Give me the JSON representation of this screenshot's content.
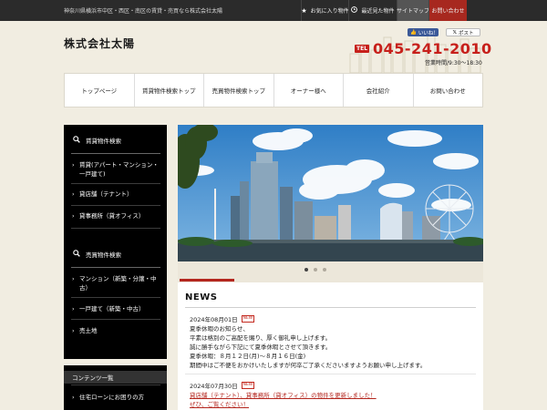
{
  "topbar": {
    "tagline": "神奈川県横浜市中区・西区・南区の賃貸・売買なら株式会社太陽",
    "links": [
      {
        "label": "お気に入り物件",
        "icon": "star-icon"
      },
      {
        "label": "最近見た物件",
        "icon": "clock-icon"
      },
      {
        "label": "サイトマップ"
      },
      {
        "label": "お問い合わせ"
      }
    ]
  },
  "header": {
    "logo": "株式会社太陽",
    "facebook_label": "いいね！",
    "x_label": "ポスト",
    "tel_label": "TEL",
    "phone": "045-241-2010",
    "hours": "営業時間/9:30～18:30"
  },
  "nav": {
    "items": [
      "トップページ",
      "賃貸物件検索トップ",
      "売買物件検索トップ",
      "オーナー様へ",
      "会社紹介",
      "お問い合わせ"
    ]
  },
  "sidebar": {
    "rental_head": "賃貸物件検索",
    "rental_items": [
      "賃貸(アパート・マンション・一戸建て)",
      "貸店舗（テナント）",
      "貸事務所（貸オフィス）"
    ],
    "sale_head": "売買物件検索",
    "sale_items": [
      "マンション（新築・分譲・中古）",
      "一戸建て（新築・中古）",
      "売土地"
    ],
    "contents_head": "コンテンツ一覧",
    "contents_items": [
      "住宅ローンにお困りの方"
    ]
  },
  "news": {
    "title": "NEWS",
    "new_label": "NEW",
    "entries": [
      {
        "date": "2024年08月01日",
        "lines": [
          "夏季休暇のお知らせ、",
          "平素は格別のご高配を賜り、厚く御礼申し上げます。",
          "誠に勝手ながら下記にて夏季休暇とさせて頂きます。",
          "夏季休暇：８月１２日(月)～８月１６日(金)",
          "期間中はご不便をおかけいたしますが何卒ご了承くださいますようお願い申し上げます。"
        ]
      },
      {
        "date": "2024年07月30日",
        "lines": [
          "貸店舗（テナント）、貸事務所（貸オフィス）の物件を更新しました！",
          "ぜひ、ご覧ください！"
        ]
      }
    ]
  },
  "colors": {
    "accent_red": "#c7201b",
    "topbar": "#2b2b2b",
    "sidebar": "#000000",
    "background": "#f1ede1"
  }
}
